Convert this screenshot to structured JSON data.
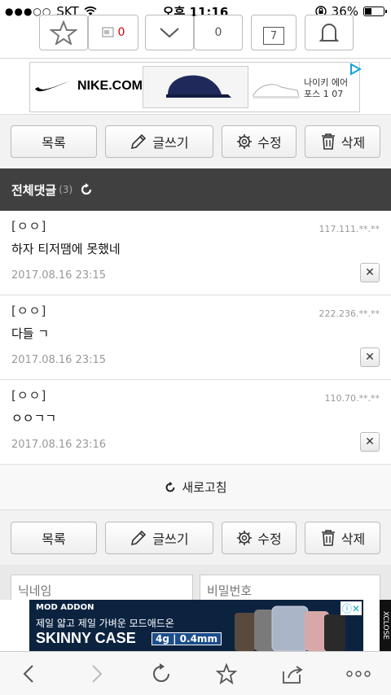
{
  "status_bar": {
    "carrier": "SKT",
    "time": "오후 11:16",
    "battery": "36%",
    "battery_level": 0.36
  },
  "top_toolbar": {
    "comment_count": "0",
    "count_value": "0",
    "page_value": "7"
  },
  "ad_top": {
    "brand": "NIKE.COM",
    "product_text_line1": "나이키 에어",
    "product_text_line2": "포스 1 07"
  },
  "actions": {
    "list_label": "목록",
    "write_label": "글쓰기",
    "edit_label": "수정",
    "delete_label": "삭제"
  },
  "comments_header": {
    "title": "전체댓글",
    "count": "(3)"
  },
  "comments": [
    {
      "nick": "[ㅇㅇ]",
      "ip": "117.111.**.**",
      "body": "하자 티저땜에 못했네",
      "date": "2017.08.16 23:15"
    },
    {
      "nick": "[ㅇㅇ]",
      "ip": "222.236.**.**",
      "body": "다들 ㄱ",
      "date": "2017.08.16 23:15"
    },
    {
      "nick": "[ㅇㅇ]",
      "ip": "110.70.**.**",
      "body": "ㅇㅇㄱㄱ",
      "date": "2017.08.16 23:16"
    }
  ],
  "refresh_label": "새로고침",
  "write_form": {
    "nickname_placeholder": "닉네임",
    "password_placeholder": "비밀번호"
  },
  "ad_bottom": {
    "brand": "MOD ADDON",
    "tagline": "제일 얇고 제일 가벼운 모드애드온",
    "headline": "SKINNY CASE",
    "spec": "4g | 0.4mm",
    "close_label": "XCLOSE"
  }
}
